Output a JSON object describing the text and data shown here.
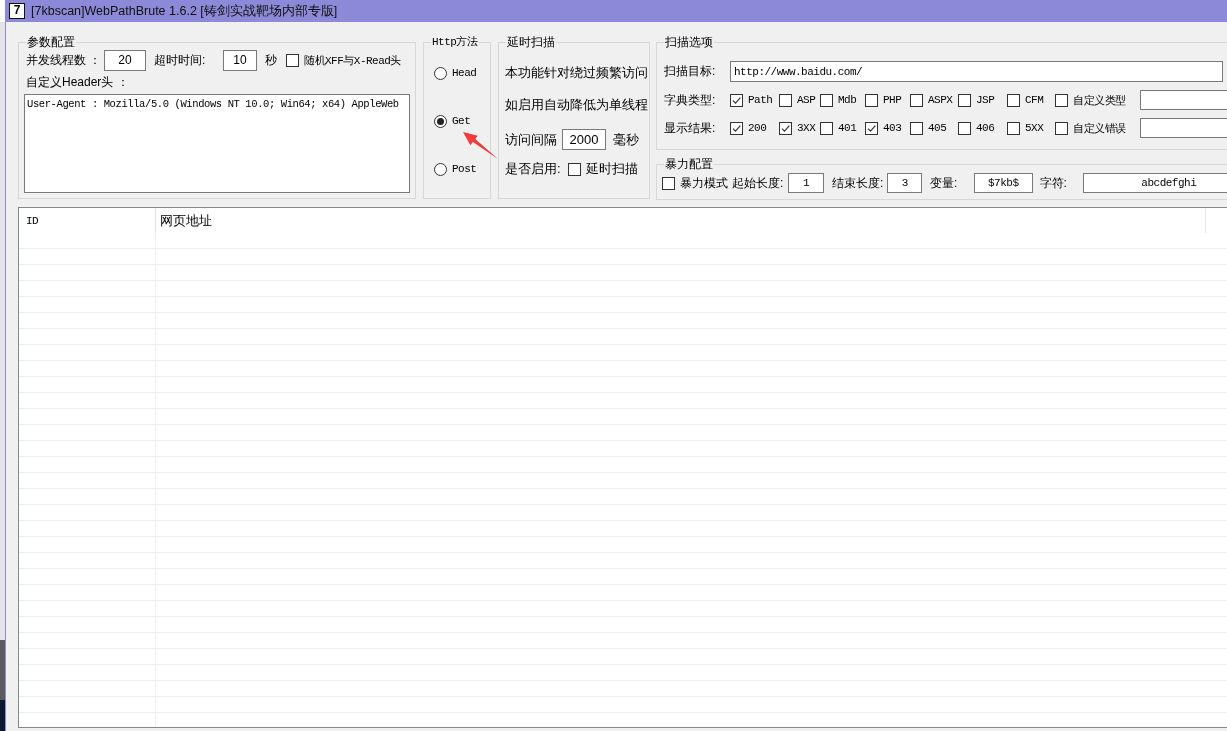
{
  "window": {
    "icon": "7",
    "title": "[7kbscan]WebPathBrute 1.6.2 [铸剑实战靶场内部专版]"
  },
  "params": {
    "title": "参数配置",
    "threads_label": "并发线程数 ：",
    "threads": "20",
    "timeout_label": "超时时间:",
    "timeout": "10",
    "timeout_unit": "秒",
    "random_xff": {
      "label": "随机XFF与X-Read头",
      "checked": false
    },
    "header_label": "自定义Header头 ：",
    "header_value": "User-Agent : Mozilla/5.0 (Windows NT 10.0; Win64; x64) AppleWeb"
  },
  "http_method": {
    "title": "Http方法",
    "options": [
      {
        "label": "Head",
        "selected": false
      },
      {
        "label": "Get",
        "selected": true
      },
      {
        "label": "Post",
        "selected": false
      }
    ]
  },
  "delay_scan": {
    "title": "延时扫描",
    "description": [
      "本功能针对绕过频繁访问",
      "如启用自动降低为单线程"
    ],
    "interval_label": "访问间隔",
    "interval": "2000",
    "interval_unit": "毫秒",
    "enable_label": "是否启用:",
    "enable": {
      "label": "延时扫描",
      "checked": false
    }
  },
  "scan_options": {
    "title": "扫描选项",
    "target_label": "扫描目标:",
    "target": "http://www.baidu.com/",
    "dict_label": "字典类型:",
    "dict_types": [
      {
        "label": "Path",
        "checked": true
      },
      {
        "label": "ASP",
        "checked": false
      },
      {
        "label": "Mdb",
        "checked": false
      },
      {
        "label": "PHP",
        "checked": false
      },
      {
        "label": "ASPX",
        "checked": false
      },
      {
        "label": "JSP",
        "checked": false
      },
      {
        "label": "CFM",
        "checked": false
      },
      {
        "label": "自定义类型",
        "checked": false
      }
    ],
    "results_label": "显示结果:",
    "results": [
      {
        "label": "200",
        "checked": true
      },
      {
        "label": "3XX",
        "checked": true
      },
      {
        "label": "401",
        "checked": false
      },
      {
        "label": "403",
        "checked": true
      },
      {
        "label": "405",
        "checked": false
      },
      {
        "label": "406",
        "checked": false
      },
      {
        "label": "5XX",
        "checked": false
      },
      {
        "label": "自定义错误",
        "checked": false
      }
    ]
  },
  "brute_force": {
    "title": "暴力配置",
    "mode": {
      "label": "暴力模式",
      "checked": false
    },
    "start_label": "起始长度:",
    "start": "1",
    "end_label": "结束长度:",
    "end": "3",
    "variable_label": "变量:",
    "variable": "$7kb$",
    "charset_label": "字符:",
    "charset": "abcdefghi"
  },
  "table": {
    "columns": [
      "ID",
      "网页地址"
    ]
  }
}
